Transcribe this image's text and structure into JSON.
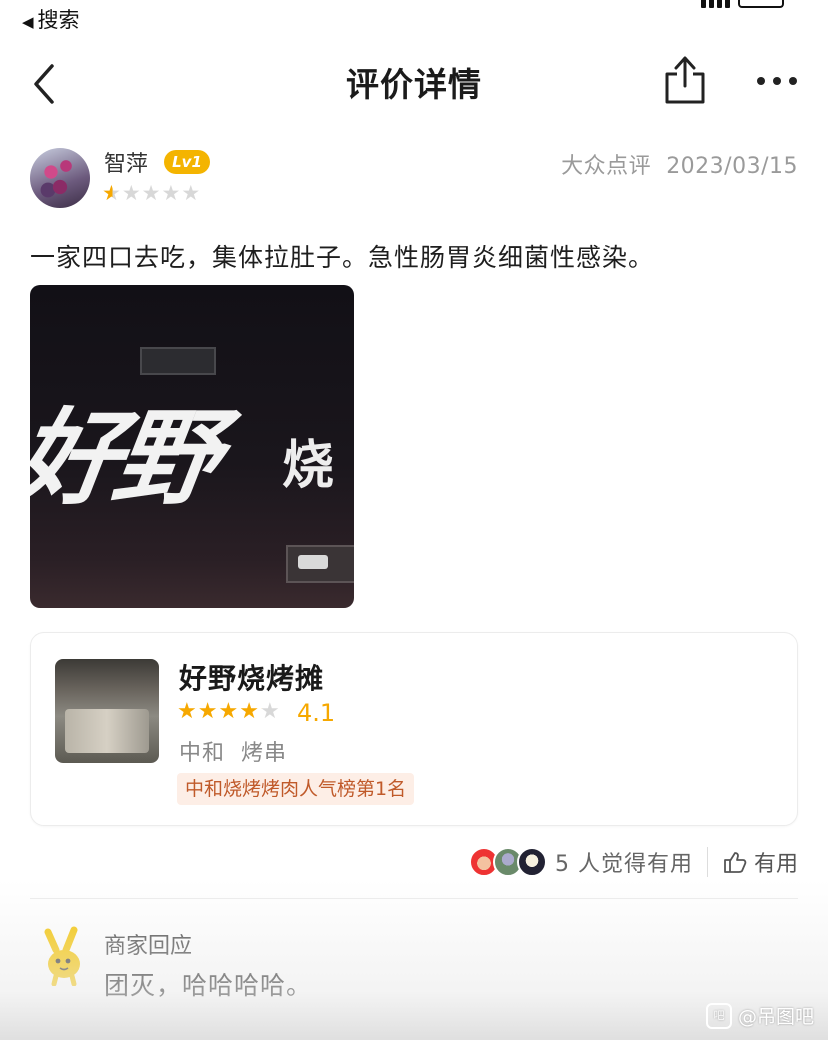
{
  "status_bar": {
    "back_app_label": "搜索",
    "back_arrow": "◀"
  },
  "nav": {
    "title": "评价详情"
  },
  "review": {
    "username": "智萍",
    "level_badge": "Lv1",
    "rating": 1,
    "max_rating": 5,
    "source": "大众点评",
    "date": "2023/03/15",
    "text": "一家四口去吃，集体拉肚子。急性肠胃炎细菌性感染。",
    "photo_text_1": "好野",
    "photo_text_2": "烧"
  },
  "shop": {
    "name": "好野烧烤摊",
    "rating": 4.1,
    "rating_display": "4.1",
    "district": "中和",
    "category": "烤串",
    "rank_tag": "中和烧烤烤肉人气榜第1名"
  },
  "useful": {
    "count_text": "5 人觉得有用",
    "button_label": "有用"
  },
  "merchant_reply": {
    "label": "商家回应",
    "text": "团灭，哈哈哈哈。"
  },
  "watermark": {
    "text": "@吊图吧",
    "icon_text": "吧"
  },
  "colors": {
    "star_active": "#f6a800",
    "star_inactive": "#d8d8d8",
    "lv_badge": "#f4b400"
  },
  "icons": {
    "back": "chevron-left-icon",
    "share": "share-icon",
    "more": "more-icon",
    "thumb": "thumbs-up-icon"
  }
}
